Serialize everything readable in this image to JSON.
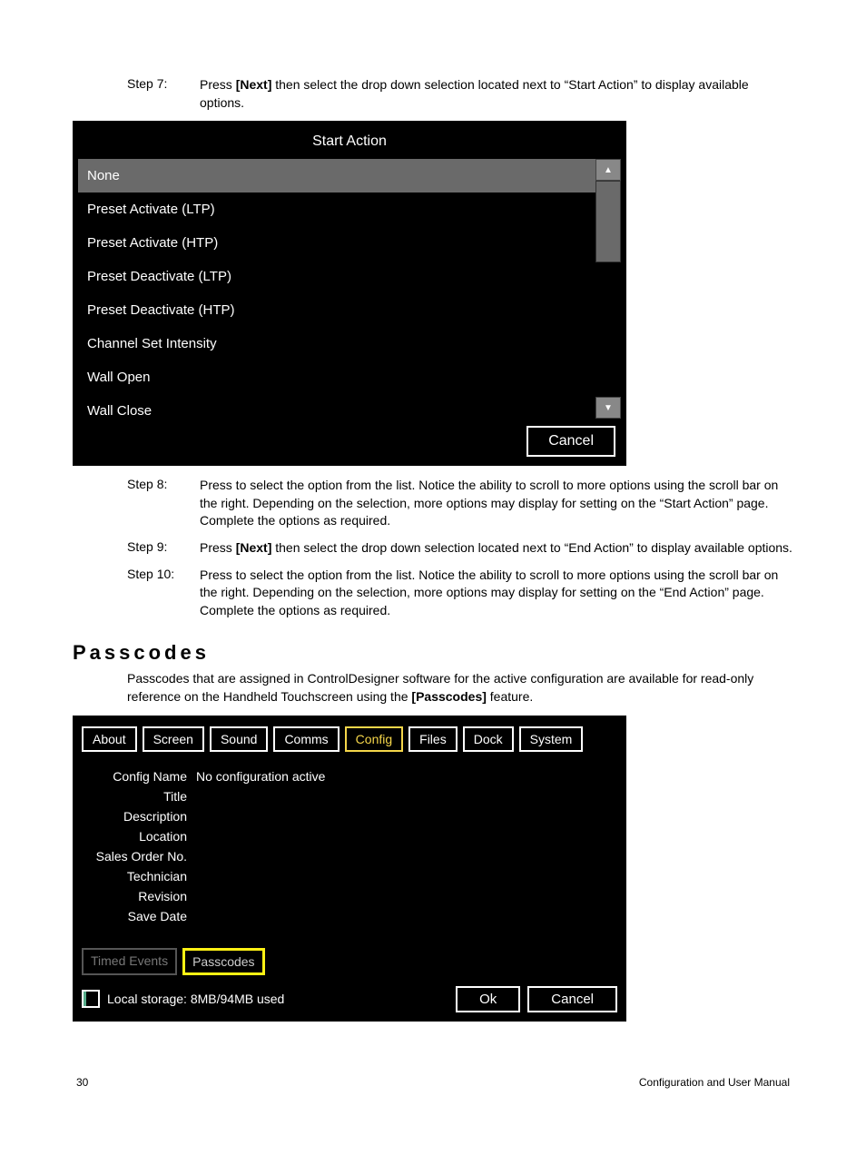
{
  "steps": {
    "s7": {
      "label": "Step 7:",
      "text_a": "Press ",
      "bold": "[Next]",
      "text_b": " then select the drop down selection located next to “Start Action” to display available options."
    },
    "s8": {
      "label": "Step 8:",
      "text": "Press to select the option from the list. Notice the ability to scroll to more options using the scroll bar on the right. Depending on the selection, more options may display for setting on the “Start Action” page. Complete the options as required."
    },
    "s9": {
      "label": "Step 9:",
      "text_a": "Press ",
      "bold": "[Next]",
      "text_b": " then select the drop down selection located next to “End Action” to display available options."
    },
    "s10": {
      "label": "Step 10:",
      "text": "Press to select the option from the list. Notice the ability to scroll to more options using the scroll bar on the right. Depending on the selection, more options may display for setting on the “End Action” page. Complete the options as required."
    }
  },
  "screenshot1": {
    "title": "Start Action",
    "items": [
      "None",
      "Preset Activate (LTP)",
      "Preset Activate (HTP)",
      "Preset Deactivate (LTP)",
      "Preset Deactivate (HTP)",
      "Channel Set Intensity",
      "Wall Open",
      "Wall Close"
    ],
    "cancel": "Cancel"
  },
  "passcodes": {
    "title": "Passcodes",
    "intro_a": "Passcodes that are assigned in ControlDesigner software for the active configuration are available for read-only reference on the Handheld Touchscreen using the ",
    "intro_bold": "[Passcodes]",
    "intro_b": " feature."
  },
  "screenshot2": {
    "tabs": [
      "About",
      "Screen",
      "Sound",
      "Comms",
      "Config",
      "Files",
      "Dock",
      "System"
    ],
    "active_tab_index": 4,
    "fields": [
      {
        "label": "Config Name",
        "value": "No configuration active"
      },
      {
        "label": "Title",
        "value": ""
      },
      {
        "label": "Description",
        "value": ""
      },
      {
        "label": "Location",
        "value": ""
      },
      {
        "label": "Sales Order No.",
        "value": ""
      },
      {
        "label": "Technician",
        "value": ""
      },
      {
        "label": "Revision",
        "value": ""
      },
      {
        "label": "Save Date",
        "value": ""
      }
    ],
    "subtabs": [
      "Timed Events",
      "Passcodes"
    ],
    "highlight_subtab_index": 1,
    "storage": "Local storage: 8MB/94MB used",
    "ok": "Ok",
    "cancel": "Cancel"
  },
  "footer": {
    "page": "30",
    "title": "Configuration and User Manual"
  }
}
